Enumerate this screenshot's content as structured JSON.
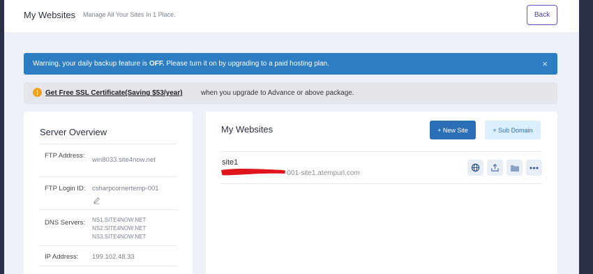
{
  "header": {
    "title": "My Websites",
    "subtitle": "Manage All Your Sites In 1 Place.",
    "back_label": "Back"
  },
  "alerts": {
    "warning_prefix": "Warning, your daily backup feature is ",
    "warning_bold": "OFF.",
    "warning_suffix": " Please turn it on by upgrading to a paid hosting plan.",
    "warning_close": "×",
    "ssl_icon": "!",
    "ssl_link": "Get Free SSL Certificate(Saving $53/year)",
    "ssl_rest": "when you upgrade to Advance or above package."
  },
  "overview": {
    "title": "Server Overview",
    "rows": [
      {
        "label": "FTP Address:",
        "value": "win8033.site4now.net"
      },
      {
        "label": "FTP Login ID:",
        "value": "csharpcornertemp-001"
      },
      {
        "label": "DNS Servers:",
        "values": [
          "NS1.SITE4NOW.NET",
          "NS2.SITE4NOW.NET",
          "NS3.SITE4NOW.NET"
        ]
      },
      {
        "label": "IP Address:",
        "value": "199.102.48.33"
      }
    ]
  },
  "sites": {
    "title": "My Websites",
    "new_site_label": "+ New Site",
    "sub_domain_label": "+ Sub Domain",
    "list": [
      {
        "name": "site1",
        "url_visible": "-001-site1.atempurl.com"
      }
    ]
  },
  "colors": {
    "warning_bg": "#2d7dc3",
    "primary_button": "#2a6fb6",
    "back_border": "#6b4cc6",
    "ssl_icon": "#f2a01b",
    "redaction": "#e0141c"
  },
  "icons": [
    "close-icon",
    "warning-icon",
    "edit-icon",
    "globe-icon",
    "upload-icon",
    "folder-icon",
    "more-icon"
  ]
}
